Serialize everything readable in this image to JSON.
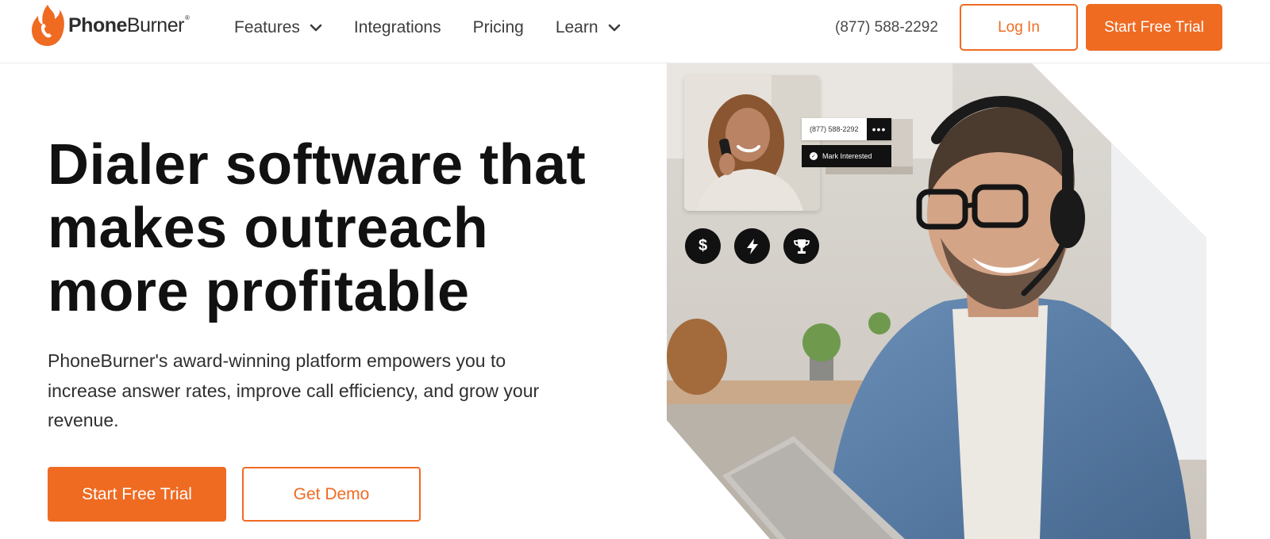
{
  "brand": {
    "name_bold": "Phone",
    "name_light": "Burner",
    "trademark": "®",
    "accent_color": "#ef6b22"
  },
  "nav": {
    "items": [
      {
        "label": "Features",
        "has_dropdown": true
      },
      {
        "label": "Integrations",
        "has_dropdown": false
      },
      {
        "label": "Pricing",
        "has_dropdown": false
      },
      {
        "label": "Learn",
        "has_dropdown": true
      }
    ],
    "phone": "(877) 588-2292",
    "login_label": "Log In",
    "trial_label": "Start Free Trial"
  },
  "hero": {
    "headline_lines": [
      "Dialer software that",
      "makes outreach",
      "more profitable"
    ],
    "subtext": "PhoneBurner's award-winning platform empowers you to increase answer rates, improve call efficiency, and grow your revenue.",
    "primary_cta": "Start Free Trial",
    "secondary_cta": "Get Demo"
  },
  "hero_image": {
    "call_card": {
      "phone": "(877) 588-2292",
      "more_label": "•••",
      "action_label": "Mark Interested"
    },
    "feature_icons": [
      "dollar-icon",
      "lightning-bolt-icon",
      "trophy-icon"
    ],
    "dollar_glyph": "$"
  }
}
